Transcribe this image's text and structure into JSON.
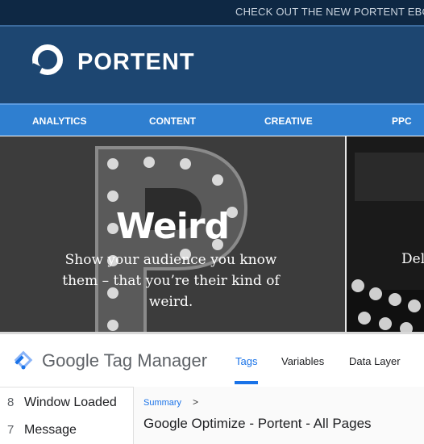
{
  "promo": {
    "text": "CHECK OUT THE NEW PORTENT EBOO"
  },
  "brand": {
    "name": "PORTENT"
  },
  "nav": {
    "items": [
      {
        "label": "ANALYTICS"
      },
      {
        "label": "CONTENT"
      },
      {
        "label": "CREATIVE"
      },
      {
        "label": "PPC"
      }
    ]
  },
  "hero": {
    "title": "Weird",
    "body": "Show your audience you know them – that you’re their kind of weird.",
    "next_slide_text": "Del"
  },
  "gtm": {
    "title": "Google Tag Manager",
    "tabs": [
      {
        "label": "Tags",
        "active": true
      },
      {
        "label": "Variables",
        "active": false
      },
      {
        "label": "Data Layer",
        "active": false
      }
    ],
    "events": [
      {
        "num": "8",
        "label": "Window Loaded"
      },
      {
        "num": "7",
        "label": "Message"
      }
    ],
    "breadcrumb": {
      "link": "Summary",
      "separator": ">"
    },
    "detail_title": "Google Optimize - Portent - All Pages"
  },
  "colors": {
    "topbar": "#0e2844",
    "header": "#1d4671",
    "nav": "#2f7fd0",
    "gtm_accent": "#1a73e8"
  }
}
